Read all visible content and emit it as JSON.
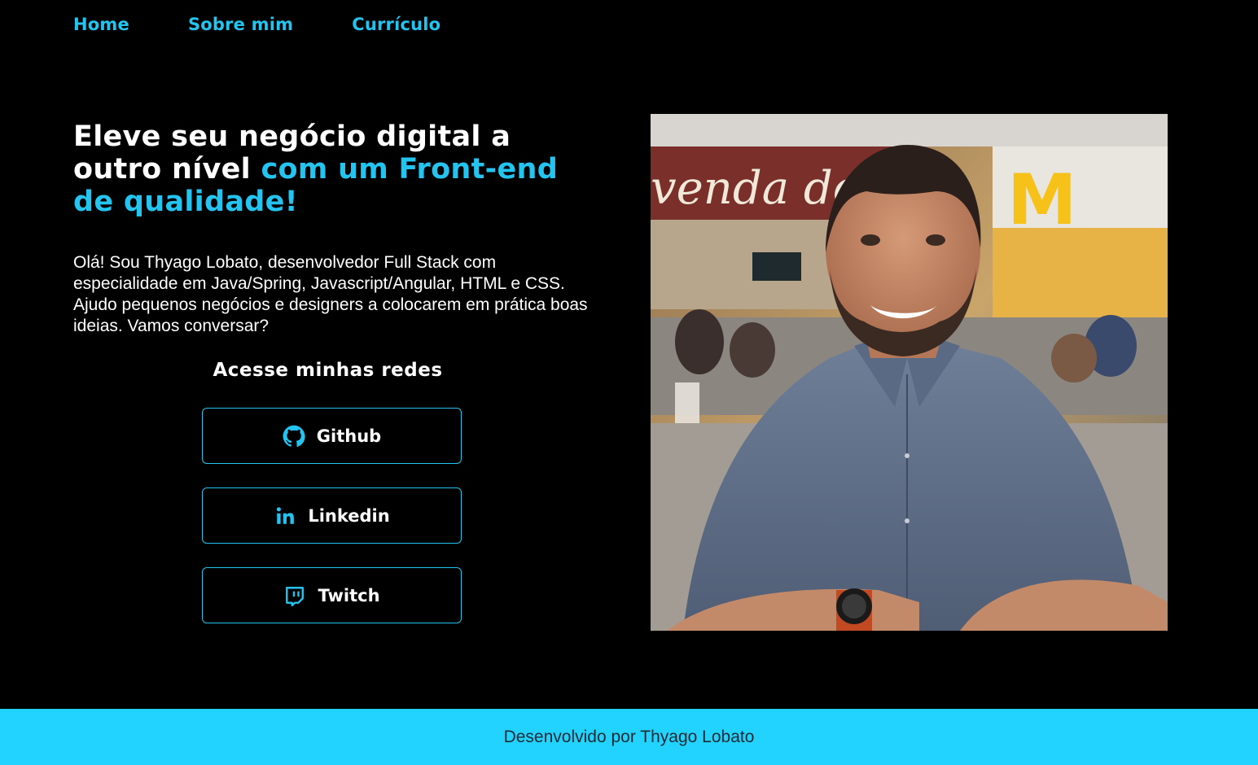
{
  "nav": {
    "home": "Home",
    "about": "Sobre mim",
    "resume": "Currículo"
  },
  "hero": {
    "headline_part1": "Eleve seu negócio digital a outro nível ",
    "headline_accent": "com um Front-end de qualidade!",
    "intro": "Olá! Sou Thyago Lobato, desenvolvedor Full Stack com especialidade em Java/Spring, Javascript/Angular, HTML e CSS. Ajudo pequenos negócios e designers a colocarem em prática boas ideias. Vamos conversar?"
  },
  "social": {
    "title": "Acesse minhas redes",
    "github": "Github",
    "linkedin": "Linkedin",
    "twitch": "Twitch"
  },
  "photo": {
    "sign_text": "venda do Co",
    "logo_text": "M"
  },
  "footer": {
    "text": "Desenvolvido por Thyago Lobato"
  },
  "colors": {
    "accent": "#23c4f0",
    "footer_bg": "#23d3ff",
    "background": "#000000"
  },
  "icons": [
    "github-icon",
    "linkedin-icon",
    "twitch-icon"
  ]
}
